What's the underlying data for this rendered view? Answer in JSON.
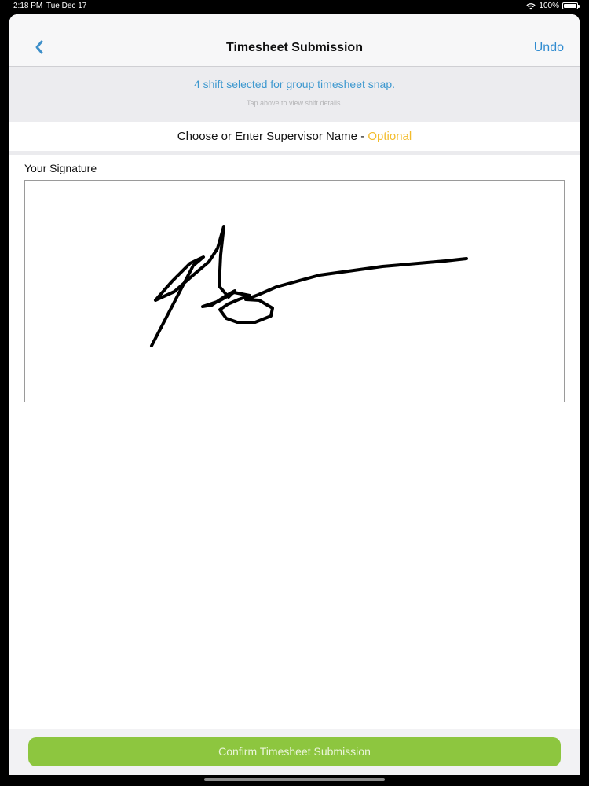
{
  "status_bar": {
    "time": "2:18 PM",
    "date": "Tue Dec 17",
    "battery": "100%",
    "icons": [
      "wifi-icon",
      "battery-icon"
    ]
  },
  "nav": {
    "back_icon": "chevron-left-icon",
    "title": "Timesheet Submission",
    "undo_label": "Undo"
  },
  "shift_banner": {
    "text": "4 shift selected for group timesheet snap.",
    "subtext": "Tap above to view shift details."
  },
  "supervisor": {
    "prompt": "Choose or Enter Supervisor Name - ",
    "optional": "Optional"
  },
  "signature": {
    "label": "Your Signature"
  },
  "confirm_label": "Confirm Timesheet Submission",
  "colors": {
    "accent_blue": "#3d98cf",
    "optional_yellow": "#f3bc2c",
    "confirm_green": "#8dc63f"
  }
}
